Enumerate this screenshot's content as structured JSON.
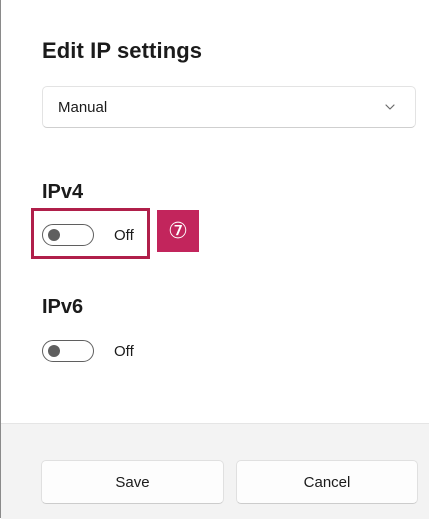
{
  "dialog": {
    "title": "Edit IP settings"
  },
  "mode_dropdown": {
    "selected": "Manual",
    "icon": "chevron-down-icon"
  },
  "ipv4": {
    "heading": "IPv4",
    "toggle_state": "Off",
    "is_on": false
  },
  "ipv6": {
    "heading": "IPv6",
    "toggle_state": "Off",
    "is_on": false
  },
  "annotation": {
    "callout_number": "⑦",
    "highlight_color": "#b01f4a",
    "badge_color": "#c2255c"
  },
  "footer": {
    "save_label": "Save",
    "cancel_label": "Cancel"
  }
}
